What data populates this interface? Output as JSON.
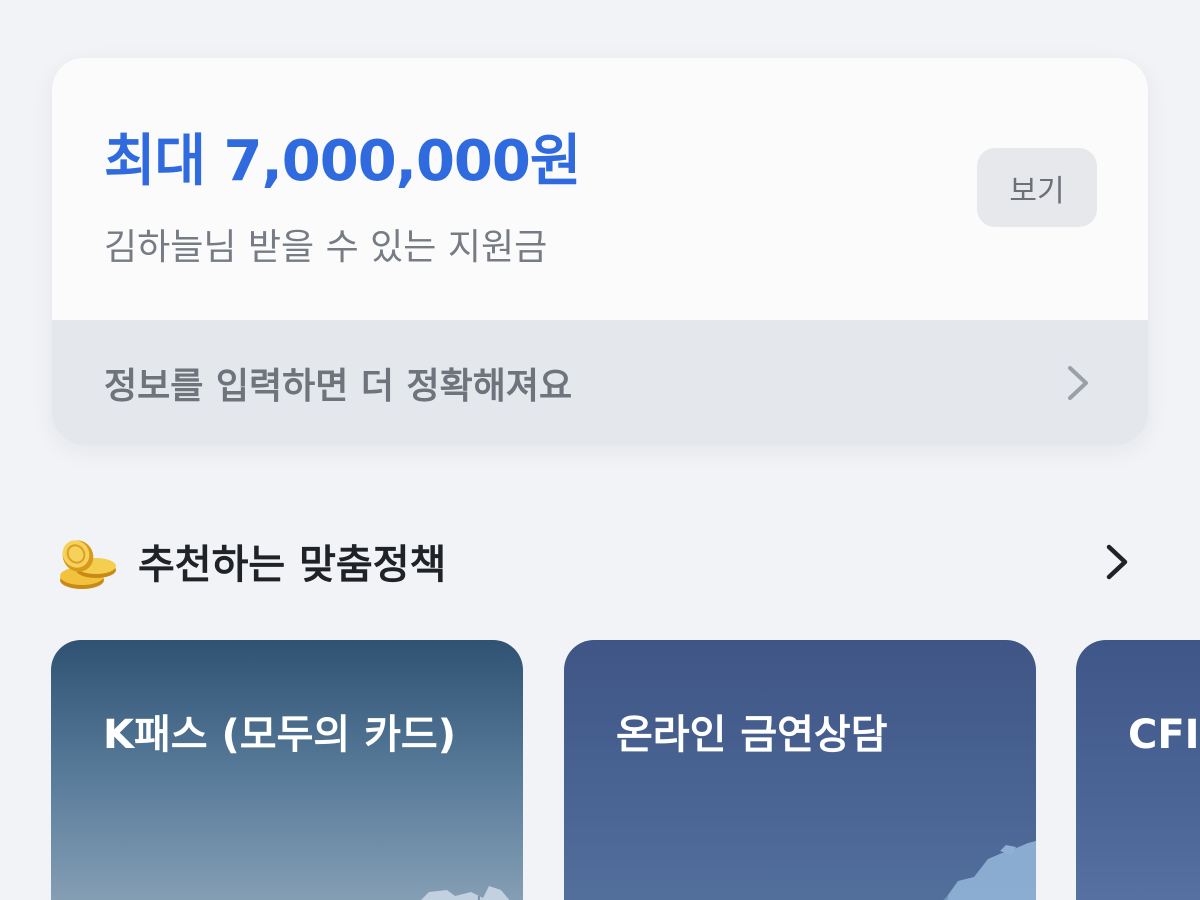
{
  "support": {
    "amount": "최대 7,000,000원",
    "subtitle": "김하늘님 받을 수 있는 지원금",
    "view_button": "보기",
    "info_prompt": "정보를 입력하면 더 정확해져요"
  },
  "recommend": {
    "title": "추천하는 맞춤정책",
    "cards": [
      {
        "title": "K패스 (모두의 카드)"
      },
      {
        "title": "온라인 금연상담"
      },
      {
        "title": "CFI 관람"
      }
    ]
  },
  "icons": {
    "section": "coins-icon",
    "chevron": "chevron-right-icon"
  },
  "colors": {
    "accent": "#2f6bdf",
    "background": "#f2f3f6"
  }
}
